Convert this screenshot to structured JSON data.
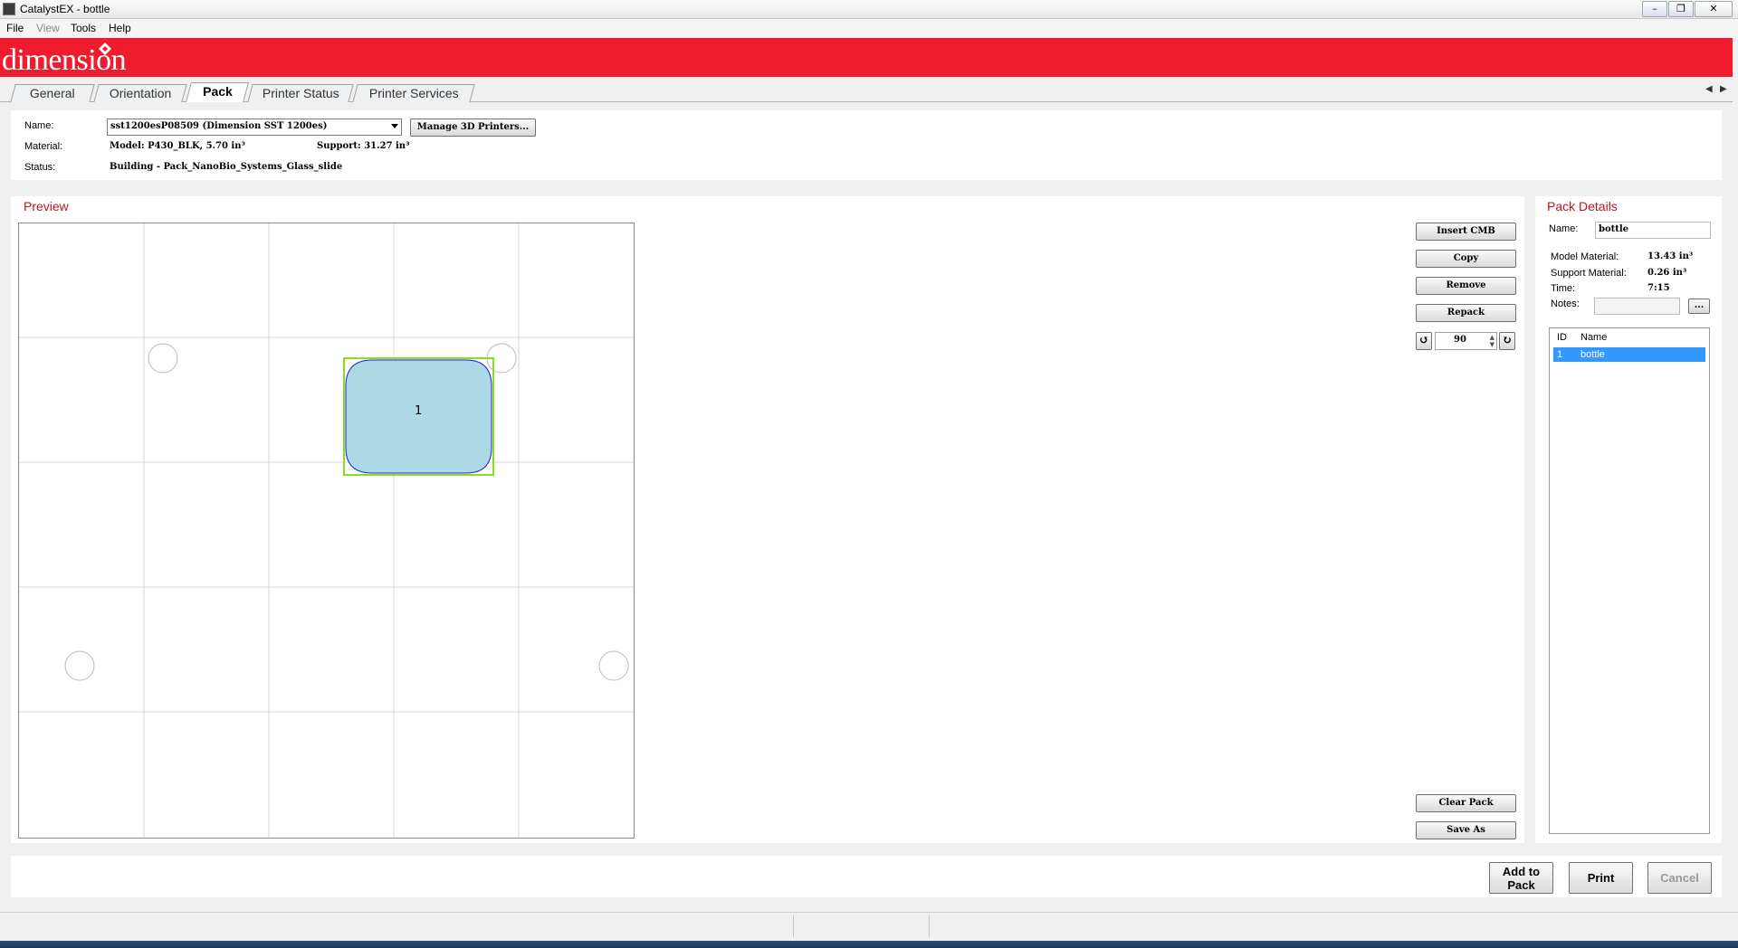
{
  "window": {
    "title": "CatalystEX - bottle"
  },
  "menu": [
    "File",
    "View",
    "Tools",
    "Help"
  ],
  "brand": {
    "logo_text": "dimension",
    "banner_color": "#ee1c2e"
  },
  "tabs": [
    "General",
    "Orientation",
    "Pack",
    "Printer Status",
    "Printer Services"
  ],
  "active_tab": "Pack",
  "printer": {
    "name_label": "Name:",
    "name_value": "sst1200esP08509  (Dimension SST 1200es)",
    "manage_button": "Manage 3D Printers...",
    "material_label": "Material:",
    "model_material": "Model: P430_BLK, 5.70 in³",
    "support_material": "Support: 31.27 in³",
    "status_label": "Status:",
    "status_value": "Building  -  Pack_NanoBio_Systems_Glass_slide"
  },
  "preview": {
    "title": "Preview",
    "part_label": "1",
    "accent_color": "#b4171e",
    "part_fill": "#add8e6",
    "part_outline": "#1f1fd6",
    "selection_color": "#7fe320"
  },
  "actions": {
    "insert": "Insert CMB",
    "copy": "Copy",
    "remove": "Remove",
    "repack": "Repack",
    "rotation_value": "90",
    "clear": "Clear Pack",
    "save_as": "Save As"
  },
  "details": {
    "title": "Pack Details",
    "name_label": "Name:",
    "name_value": "bottle",
    "model_label": "Model Material:",
    "model_value": "13.43 in³",
    "support_label": "Support Material:",
    "support_value": "0.26 in³",
    "time_label": "Time:",
    "time_value": "7:15",
    "notes_label": "Notes:",
    "notes_button": "...",
    "list_headers": [
      "ID",
      "Name"
    ],
    "list_rows": [
      {
        "id": "1",
        "name": "bottle"
      }
    ]
  },
  "footer": {
    "add_to_pack_line1": "Add to",
    "add_to_pack_line2": "Pack",
    "print": "Print",
    "cancel": "Cancel"
  }
}
